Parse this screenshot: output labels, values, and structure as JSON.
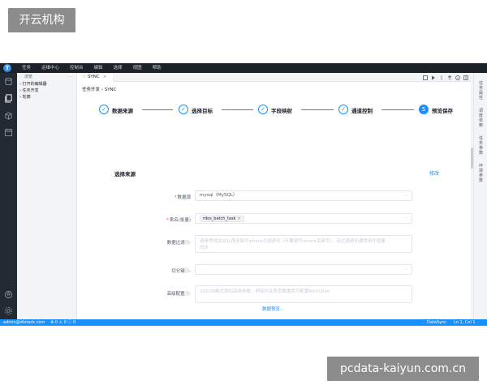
{
  "watermarks": {
    "top": "开云机构",
    "bottom": "pcdata-kaiyun.com.cn"
  },
  "menubar": {
    "logo": "T",
    "items": [
      "任务",
      "运维中心",
      "控制台",
      "编辑",
      "选择",
      "视图",
      "帮助"
    ]
  },
  "explorer": {
    "title": "浏览",
    "more": "···",
    "items": [
      "› 打开的编辑器",
      "› 任务开发",
      "› 轮廓"
    ]
  },
  "tabs": [
    {
      "label": "SYNC",
      "icon": "☆",
      "close": "×"
    }
  ],
  "breadcrumb": "任务开发 › SYNC",
  "steps": [
    {
      "label": "数据来源",
      "mark": "✓",
      "state": "done"
    },
    {
      "label": "选择目标",
      "mark": "✓",
      "state": "done"
    },
    {
      "label": "字段映射",
      "mark": "✓",
      "state": "done"
    },
    {
      "label": "通道控制",
      "mark": "✓",
      "state": "done"
    },
    {
      "label": "预览保存",
      "mark": "5",
      "state": "active"
    }
  ],
  "section": {
    "title": "选择来源",
    "edit_link": "修改"
  },
  "form": {
    "datasource": {
      "label": "数据源",
      "required": true,
      "value": "mysql（MySQL）",
      "arrow": "⌵"
    },
    "table": {
      "label": "表名(批量)",
      "required": true,
      "tag": "rdos_batch_task",
      "tag_close": "×",
      "arrow": "⌵"
    },
    "filter": {
      "label": "数据过滤",
      "placeholder": "请参考相关SQL语法填写where过滤语句（不要填写where关键字），该过滤语句通常用作增量",
      "placeholder_line2": "同步"
    },
    "split": {
      "label": "切分键",
      "arrow": "⌵"
    },
    "advanced": {
      "label": "高级配置",
      "placeholder": "以JSON格式添加高级参数，例如对关系型数据库可配置fetchSize"
    }
  },
  "preview_link": "数据预览⌵",
  "right_panel": [
    "任务属性",
    "调度依赖",
    "任务参数",
    "环境参数"
  ],
  "statusbar": {
    "user": "admin@dtstack.com",
    "counts": "⊗ 0 ⚠ 0 ⓘ 0",
    "mode": "DataSync",
    "position": "Ln 1, Col 1"
  },
  "colors": {
    "accent": "#1890ff",
    "menubar": "#1d2129",
    "activity": "#242a33",
    "statusbar": "#1890ff"
  }
}
